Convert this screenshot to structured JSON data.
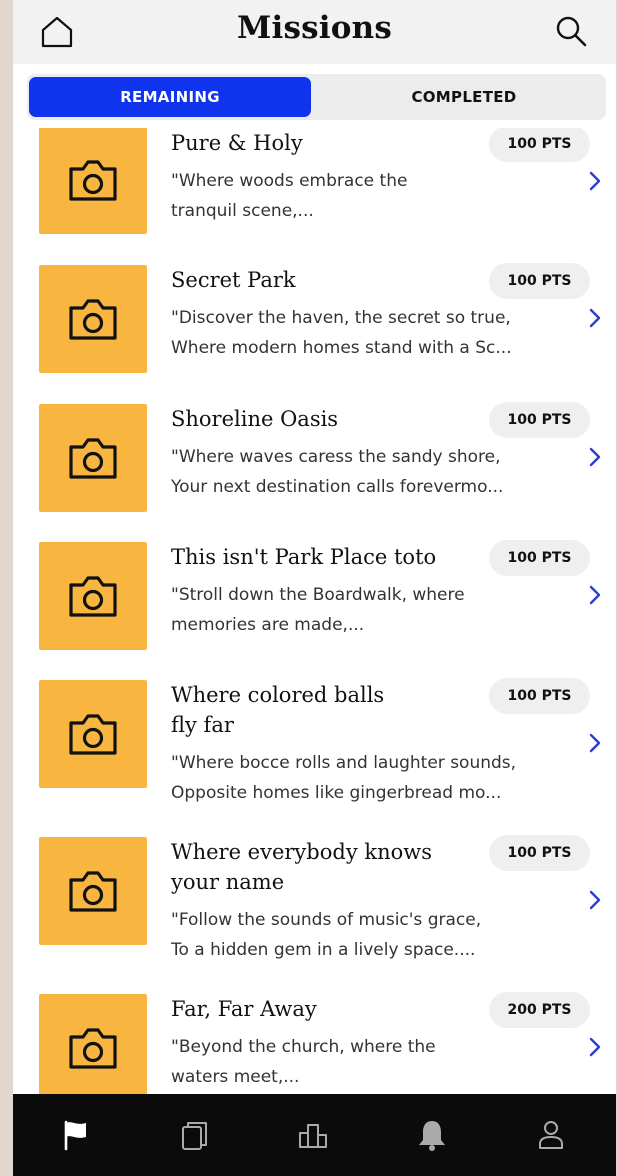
{
  "header": {
    "title": "Missions",
    "home_icon": "home-icon",
    "search_icon": "search-icon"
  },
  "tabs": [
    {
      "label": "REMAINING",
      "active": true
    },
    {
      "label": "COMPLETED",
      "active": false
    }
  ],
  "missions": [
    {
      "title_lines": [
        "Pure & Holy"
      ],
      "points": "100 PTS",
      "desc_lines": [
        "\"Where woods embrace the",
        "tranquil scene,..."
      ],
      "icon": "camera-icon"
    },
    {
      "title_lines": [
        "Secret Park"
      ],
      "points": "100 PTS",
      "desc_lines": [
        "\"Discover the haven, the secret so true,",
        "Where modern homes stand with a Sc..."
      ],
      "icon": "camera-icon"
    },
    {
      "title_lines": [
        "Shoreline Oasis"
      ],
      "points": "100 PTS",
      "desc_lines": [
        "\"Where waves caress the sandy shore,",
        "Your next destination calls forevermo..."
      ],
      "icon": "camera-icon"
    },
    {
      "title_lines": [
        "This isn't Park Place toto"
      ],
      "points": "100 PTS",
      "desc_lines": [
        "\"Stroll down the Boardwalk, where",
        "memories are made,..."
      ],
      "icon": "camera-icon"
    },
    {
      "title_lines": [
        "Where colored balls",
        "fly far"
      ],
      "points": "100 PTS",
      "desc_lines": [
        "\"Where bocce rolls and laughter sounds,",
        "Opposite homes like gingerbread mo..."
      ],
      "icon": "camera-icon"
    },
    {
      "title_lines": [
        "Where everybody knows",
        "your name"
      ],
      "points": "100 PTS",
      "desc_lines": [
        "\"Follow the sounds of music's grace,",
        "To a hidden gem in a lively space...."
      ],
      "icon": "camera-icon"
    },
    {
      "title_lines": [
        "Far, Far Away"
      ],
      "points": "200 PTS",
      "desc_lines": [
        "\"Beyond the church, where the",
        "waters meet,..."
      ],
      "icon": "camera-icon"
    }
  ],
  "bottom_nav": [
    {
      "name": "missions",
      "icon": "flag-icon",
      "active": true
    },
    {
      "name": "cards",
      "icon": "cards-icon",
      "active": false
    },
    {
      "name": "leaderboard",
      "icon": "leaderboard-icon",
      "active": false
    },
    {
      "name": "notifications",
      "icon": "bell-icon",
      "active": false
    },
    {
      "name": "profile",
      "icon": "profile-icon",
      "active": false
    }
  ],
  "colors": {
    "accent": "#1033ee",
    "thumbnail": "#f8b640",
    "chevron": "#2b3fcf",
    "nav_background": "#0b0b0b"
  }
}
